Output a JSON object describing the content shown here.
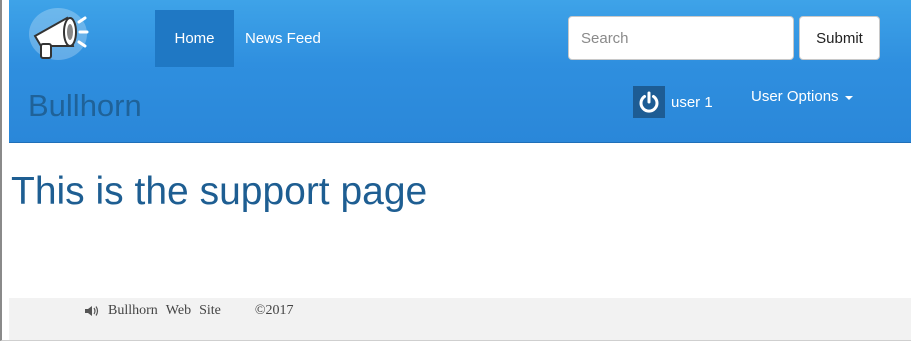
{
  "header": {
    "nav": [
      {
        "label": "Home",
        "active": true
      },
      {
        "label": "News Feed",
        "active": false
      }
    ],
    "search": {
      "placeholder": "Search",
      "value": "",
      "submit_label": "Submit"
    },
    "brand": "Bullhorn",
    "user": {
      "name": "user 1",
      "icon": "power-icon"
    },
    "user_options_label": "User Options",
    "logo_icon": "megaphone-icon"
  },
  "main": {
    "heading": "This is the support page"
  },
  "footer": {
    "icon": "speaker-icon",
    "brand": "Bullhorn",
    "web": "Web",
    "site": "Site",
    "copyright": "©2017"
  },
  "colors": {
    "navbar": "#2f8fdf",
    "nav_active": "#1f78c4",
    "heading": "#1e5e92",
    "footer_bg": "#f2f2f2"
  }
}
